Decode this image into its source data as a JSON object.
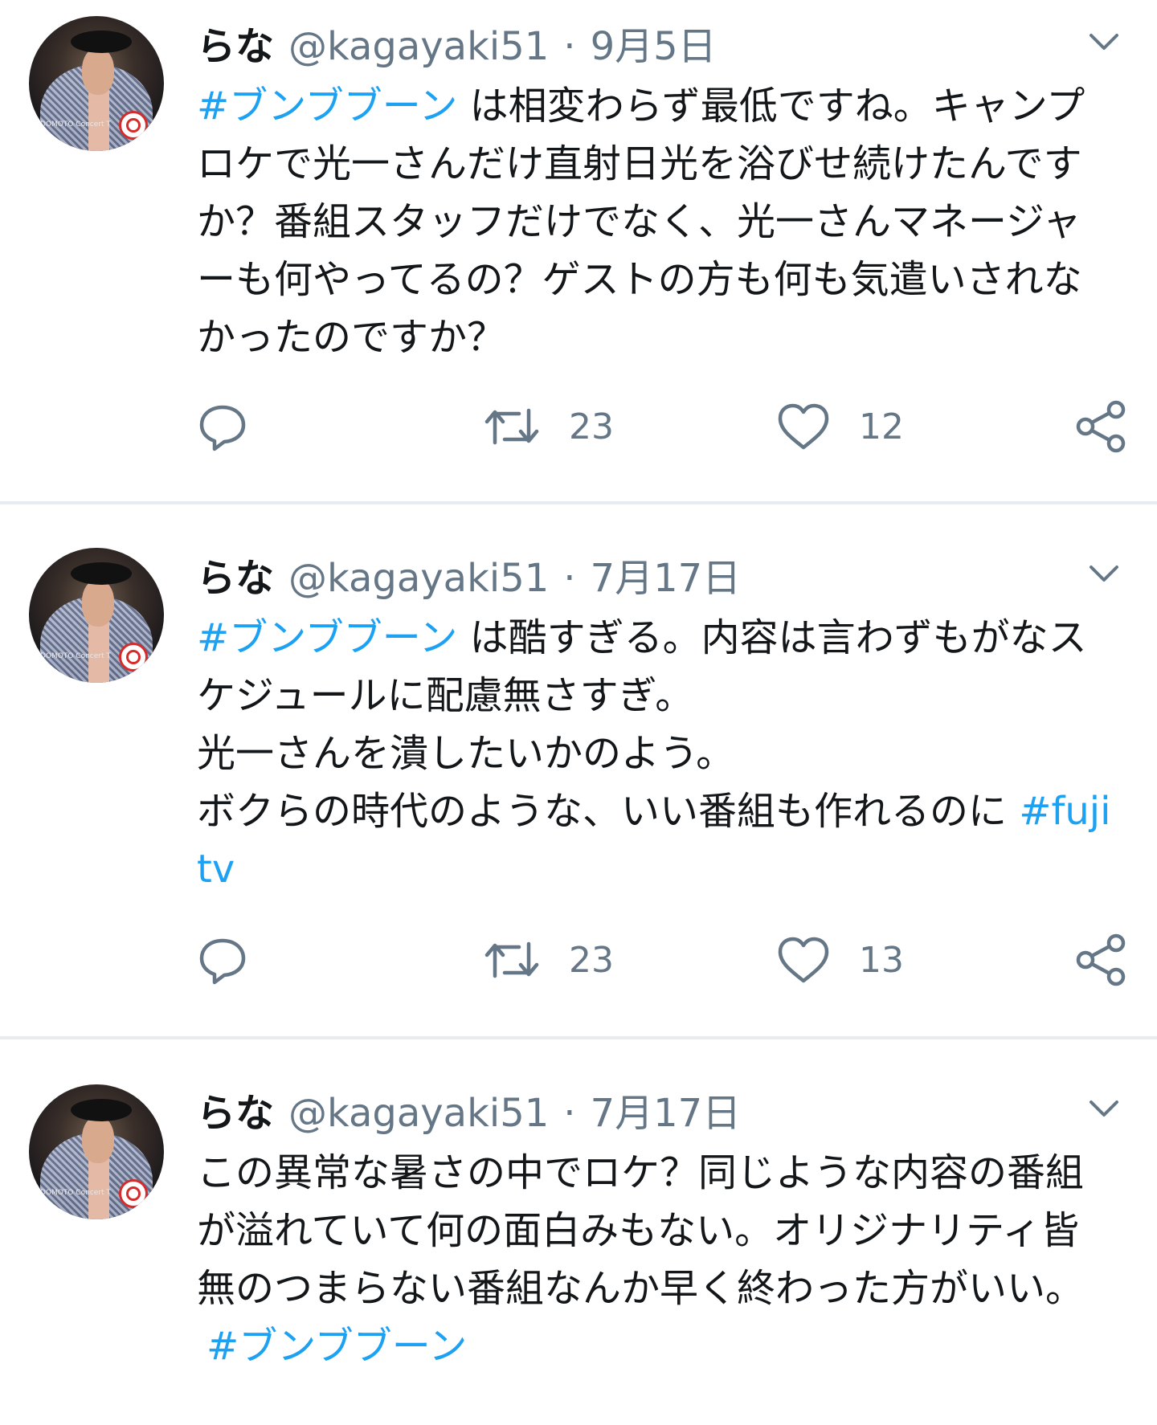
{
  "tweets": [
    {
      "name": "らな",
      "handle": "@kagayaki51",
      "separator": "·",
      "date": "9月5日",
      "hashtag_lead": "#ブンブブーン",
      "text": " は相変わらず最低ですね。キャンプロケで光一さんだけ直射日光を浴びせ続けたんですか？番組スタッフだけでなく、光一さんマネージャーも何やってるの？ゲストの方も何も気遣いされなかったのですか？",
      "hashtag_tail": "",
      "retweets": "23",
      "likes": "12"
    },
    {
      "name": "らな",
      "handle": "@kagayaki51",
      "separator": "·",
      "date": "7月17日",
      "hashtag_lead": "#ブンブブーン",
      "text": " は酷すぎる。内容は言わずもがなスケジュールに配慮無さすぎ。\n光一さんを潰したいかのよう。\nボクらの時代のような、いい番組も作れるのに ",
      "hashtag_tail": "#fujitv",
      "retweets": "23",
      "likes": "13"
    },
    {
      "name": "らな",
      "handle": "@kagayaki51",
      "separator": "·",
      "date": "7月17日",
      "hashtag_lead": "",
      "text": "この異常な暑さの中でロケ？同じような内容の番組が溢れていて何の面白みもない。オリジナリティ皆無のつまらない番組なんか早く終わった方がいい。",
      "hashtag_tail": "#ブンブブーン"
    }
  ],
  "avatar_caption": "DOMOTO Concert T",
  "icons": [
    "reply-icon",
    "retweet-icon",
    "like-icon",
    "share-icon",
    "chevron-down-icon"
  ],
  "colors": {
    "hashtag": "#1da1f2",
    "meta": "#657786",
    "text": "#14171a",
    "separator": "#e6ecf0"
  }
}
